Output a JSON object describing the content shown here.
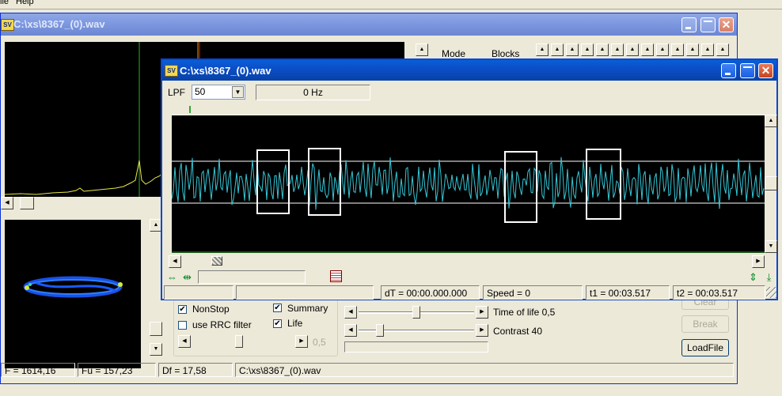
{
  "menu": [
    "ile",
    "Help"
  ],
  "back_window": {
    "title": "C:\\xs\\8367_(0).wav",
    "mode_label": "Mode",
    "blocks_label": "Blocks",
    "status": [
      "F = 1614,16",
      "Fu = 157,23",
      "Df = 17,58",
      "C:\\xs\\8367_(0).wav"
    ],
    "options": {
      "nonstop": {
        "label": "NonStop",
        "checked": true
      },
      "summary": {
        "label": "Summary",
        "checked": true
      },
      "rrc": {
        "label": "use RRC filter",
        "checked": false
      },
      "life": {
        "label": "Life",
        "checked": true
      }
    },
    "rrc_value": "0,5",
    "time_of_life_label": "Time of life 0,5",
    "contrast_label": "Contrast 40",
    "buttons": {
      "break": "Break",
      "load": "LoadFile",
      "clear": "Clear"
    }
  },
  "front_window": {
    "title": "C:\\xs\\8367_(0).wav",
    "lpf_label": "LPF",
    "lpf_value": "50",
    "freq_readout": "0 Hz",
    "status": {
      "dt": "dT = 00:00.000.000",
      "speed": "Speed = 0",
      "t1": "t1 = 00:03.517",
      "t2": "t2 = 00:03.517"
    }
  },
  "colors": {
    "waveform": "#36c7d6",
    "spectrum": "#e8e84a",
    "constellation": "#1a5aff"
  }
}
